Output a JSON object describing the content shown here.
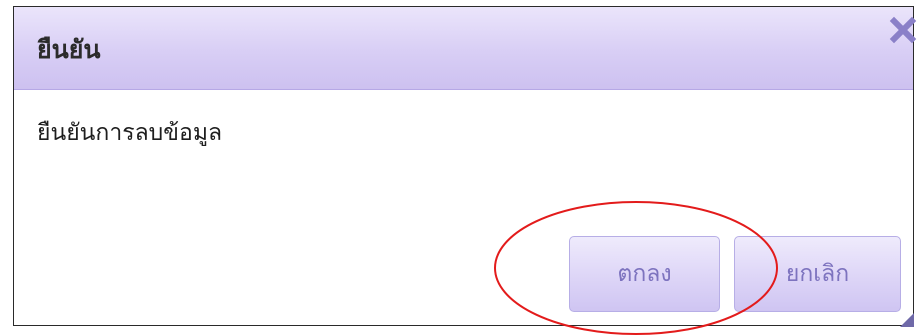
{
  "dialog": {
    "title": "ยืนยัน",
    "message": "ยืนยันการลบข้อมูล",
    "ok_label": "ตกลง",
    "cancel_label": "ยกเลิก",
    "close_icon": "close-icon",
    "resize_icon": "resize-grip-icon"
  },
  "colors": {
    "titlebar": "#d8cef5",
    "button_fill": "#ddd5f7",
    "button_text": "#7d73bf",
    "close_icon": "#8a80c8",
    "annotation_circle": "#e31b1b"
  }
}
